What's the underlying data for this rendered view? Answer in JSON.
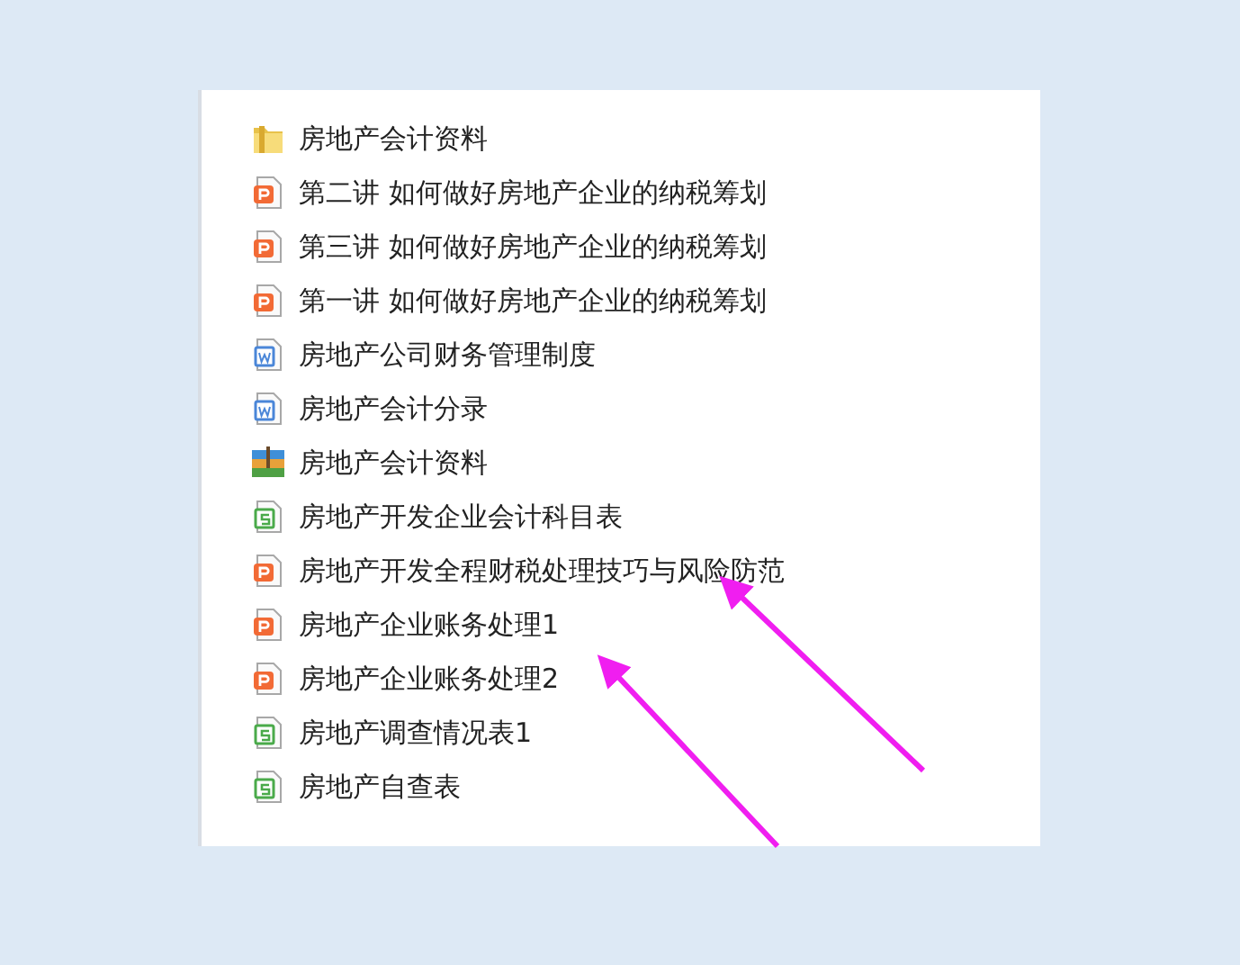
{
  "files": [
    {
      "kind": "folder",
      "name": "房地产会计资料"
    },
    {
      "kind": "ppt",
      "name": "第二讲 如何做好房地产企业的纳税筹划"
    },
    {
      "kind": "ppt",
      "name": "第三讲 如何做好房地产企业的纳税筹划"
    },
    {
      "kind": "ppt",
      "name": "第一讲 如何做好房地产企业的纳税筹划"
    },
    {
      "kind": "word",
      "name": "房地产公司财务管理制度"
    },
    {
      "kind": "word",
      "name": "房地产会计分录"
    },
    {
      "kind": "archive",
      "name": "房地产会计资料"
    },
    {
      "kind": "sheet",
      "name": "房地产开发企业会计科目表"
    },
    {
      "kind": "ppt",
      "name": "房地产开发全程财税处理技巧与风险防范"
    },
    {
      "kind": "ppt",
      "name": "房地产企业账务处理1"
    },
    {
      "kind": "ppt",
      "name": "房地产企业账务处理2"
    },
    {
      "kind": "sheet",
      "name": "房地产调查情况表1"
    },
    {
      "kind": "sheet",
      "name": "房地产自查表"
    }
  ]
}
